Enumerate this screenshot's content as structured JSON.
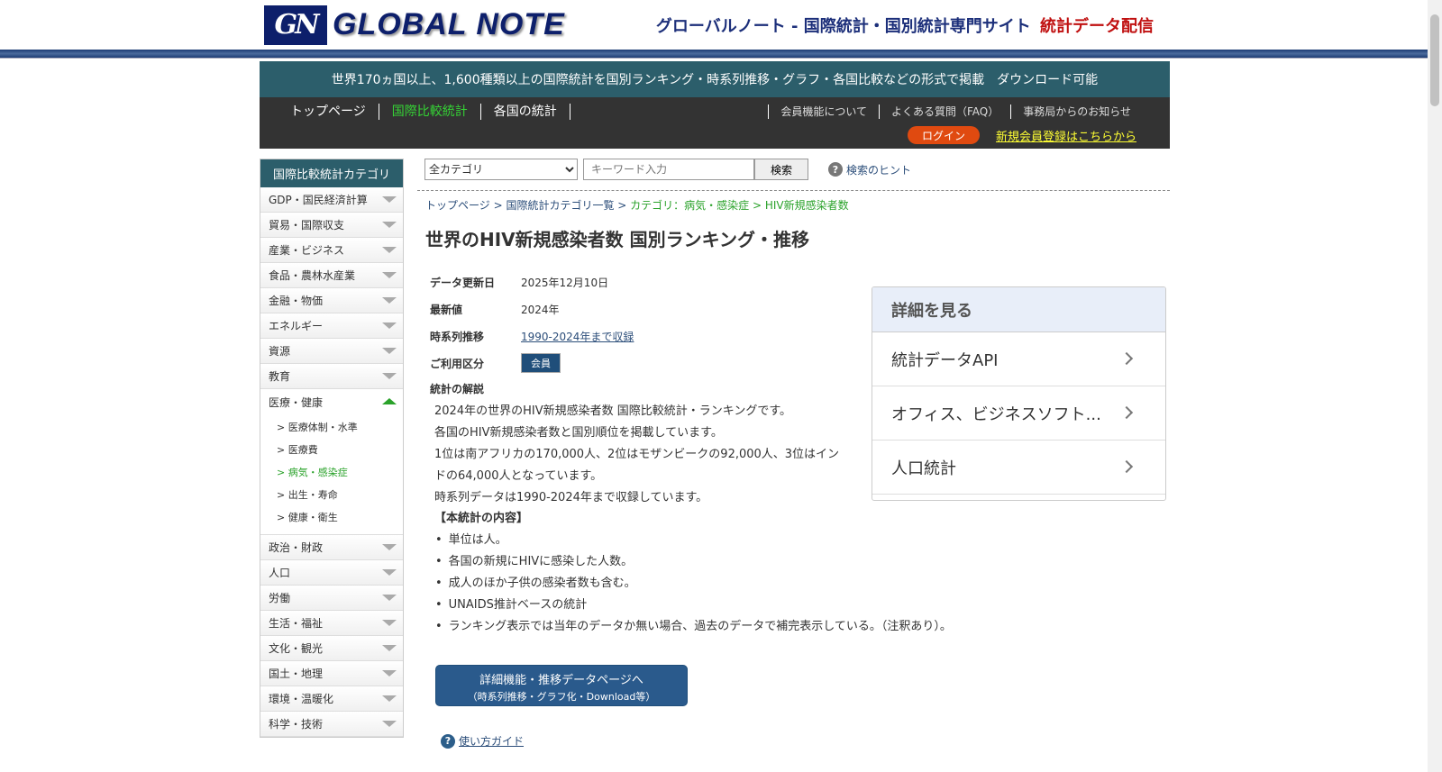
{
  "header": {
    "logo_mark": "GN",
    "logo_text": "GLOBAL NOTE",
    "tagline": "グローバルノート - 国際統計・国別統計専門サイト",
    "tagline_highlight": "統計データ配信"
  },
  "banner": "世界170ヵ国以上、1,600種類以上の国際統計を国別ランキング・時系列推移・グラフ・各国比較などの形式で掲載　ダウンロード可能",
  "nav": {
    "main": [
      "トップページ",
      "国際比較統計",
      "各国の統計"
    ],
    "secondary": [
      "会員機能について",
      "よくある質問（FAQ）",
      "事務局からのお知らせ"
    ],
    "login": "ログイン",
    "register": "新規会員登録はこちらから"
  },
  "sidebar": {
    "title": "国際比較統計カテゴリ",
    "categories_before": [
      "GDP・国民経済計算",
      "貿易・国際収支",
      "産業・ビジネス",
      "食品・農林水産業",
      "金融・物価",
      "エネルギー",
      "資源",
      "教育"
    ],
    "open_category": "医療・健康",
    "subcategories": [
      "> 医療体制・水準",
      "> 医療費",
      "> 病気・感染症",
      "> 出生・寿命",
      "> 健康・衛生"
    ],
    "categories_after": [
      "政治・財政",
      "人口",
      "労働",
      "生活・福祉",
      "文化・観光",
      "国土・地理",
      "環境・温暖化",
      "科学・技術"
    ]
  },
  "search": {
    "category_selected": "全カテゴリ",
    "placeholder": "キーワード入力",
    "button": "検索",
    "hint": "検索のヒント"
  },
  "breadcrumb": {
    "top": "トップページ",
    "list": "国際統計カテゴリ一覧",
    "category": "カテゴリ：病気・感染症",
    "current": "HIV新規感染者数",
    "separator": " > "
  },
  "page_title": "世界のHIV新規感染者数 国別ランキング・推移",
  "info": {
    "updated_label": "データ更新日",
    "updated_value": "2025年12月10日",
    "latest_label": "最新値",
    "latest_value": "2024年",
    "series_label": "時系列推移",
    "series_value": "1990-2024年まで収録",
    "usage_label": "ご利用区分",
    "usage_value": "会員"
  },
  "description": {
    "heading": "統計の解説",
    "paragraphs": [
      "2024年の世界のHIV新規感染者数 国際比較統計・ランキングです。",
      "各国のHIV新規感染者数と国別順位を掲載しています。",
      "1位は南アフリカの170,000人、2位はモザンビークの92,000人、3位はインドの64,000人となっています。",
      "時系列データは1990-2024年まで収録しています。"
    ],
    "contents_heading": "【本統計の内容】",
    "contents": [
      "単位は人。",
      "各国の新規にHIVに感染した人数。",
      "成人のほか子供の感染者数も含む。",
      "UNAIDS推計ベースの統計",
      "ランキング表示では当年のデータか無い場合、過去のデータで補完表示している。（注釈あり）。"
    ]
  },
  "detail_button": {
    "line1": "詳細機能・推移データページへ",
    "line2": "（時系列推移・グラフ化・Download等）"
  },
  "usage_guide": "使い方ガイド",
  "panel": {
    "heading": "詳細を見る",
    "items": [
      "統計データAPI",
      "オフィス、ビジネスソフト...",
      "人口統計"
    ]
  }
}
